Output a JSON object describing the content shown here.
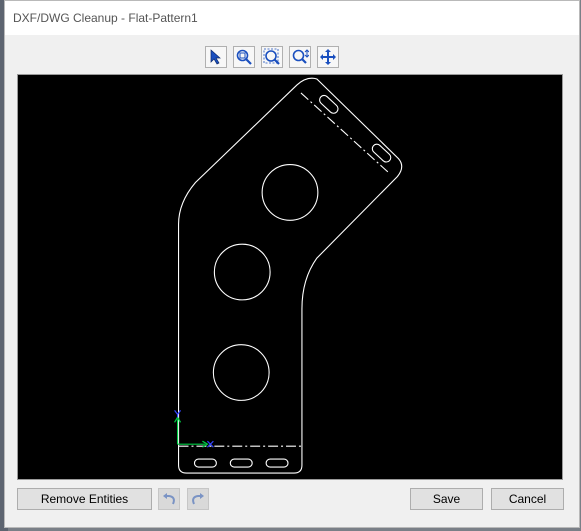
{
  "window": {
    "title": "DXF/DWG Cleanup - Flat-Pattern1"
  },
  "toolbar": {
    "items": [
      {
        "icon": "select-icon"
      },
      {
        "icon": "zoom-fit-icon"
      },
      {
        "icon": "zoom-area-icon"
      },
      {
        "icon": "zoom-in-out-icon"
      },
      {
        "icon": "pan-icon"
      }
    ]
  },
  "actions": {
    "remove_label": "Remove Entities",
    "undo_icon": "undo-icon",
    "redo_icon": "redo-icon",
    "save_label": "Save",
    "cancel_label": "Cancel"
  },
  "colors": {
    "viewport_bg": "#000000",
    "geometry": "#ffffff",
    "axis_x": "#00cc44",
    "axis_y": "#3344ff",
    "icon_blue": "#1a4fbf"
  }
}
